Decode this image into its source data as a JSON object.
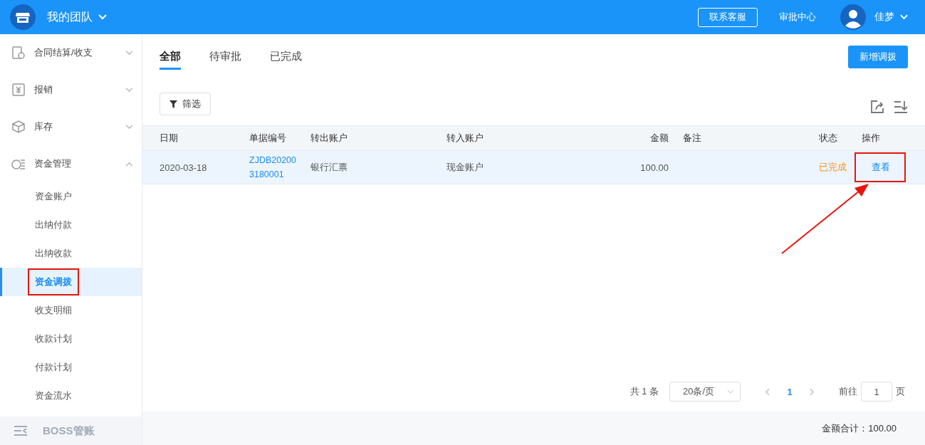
{
  "header": {
    "team": "我的团队",
    "service_button": "联系客服",
    "approval_link": "审批中心",
    "user": "佳梦"
  },
  "sidebar": {
    "groups": [
      {
        "label": "合同结算/收支",
        "expanded": false
      },
      {
        "label": "报销",
        "expanded": false
      },
      {
        "label": "库存",
        "expanded": false
      },
      {
        "label": "资金管理",
        "expanded": true,
        "children": [
          {
            "label": "资金账户",
            "selected": false,
            "annotated": false
          },
          {
            "label": "出纳付款",
            "selected": false,
            "annotated": false
          },
          {
            "label": "出纳收款",
            "selected": false,
            "annotated": false
          },
          {
            "label": "资金调拨",
            "selected": true,
            "annotated": true
          },
          {
            "label": "收支明细",
            "selected": false,
            "annotated": false
          },
          {
            "label": "收款计划",
            "selected": false,
            "annotated": false
          },
          {
            "label": "付款计划",
            "selected": false,
            "annotated": false
          },
          {
            "label": "资金流水",
            "selected": false,
            "annotated": false
          }
        ]
      }
    ],
    "footer": {
      "label": "BOSS管账",
      "disabled": true
    }
  },
  "tabs": [
    {
      "label": "全部",
      "selected": true
    },
    {
      "label": "待审批",
      "selected": false
    },
    {
      "label": "已完成",
      "selected": false
    }
  ],
  "add_button": "新增调拨",
  "filter_button": "筛选",
  "table": {
    "columns": [
      "日期",
      "单据编号",
      "转出账户",
      "转入账户",
      "金额",
      "备注",
      "状态",
      "操作"
    ],
    "rows": [
      {
        "date": "2020-03-18",
        "number": "ZJDB202003180001",
        "from": "银行汇票",
        "to": "现金账户",
        "amount": "100.00",
        "status": "已完成",
        "action": "查看",
        "action_annotated": true
      }
    ]
  },
  "pagination": {
    "total": "共 1 条",
    "page_size": "20条/页",
    "pages": [
      {
        "label": "1",
        "selected": true
      }
    ],
    "goto_label": "前往",
    "goto_value": "1",
    "page_unit": "页"
  },
  "summary": "金额合计：100.00"
}
